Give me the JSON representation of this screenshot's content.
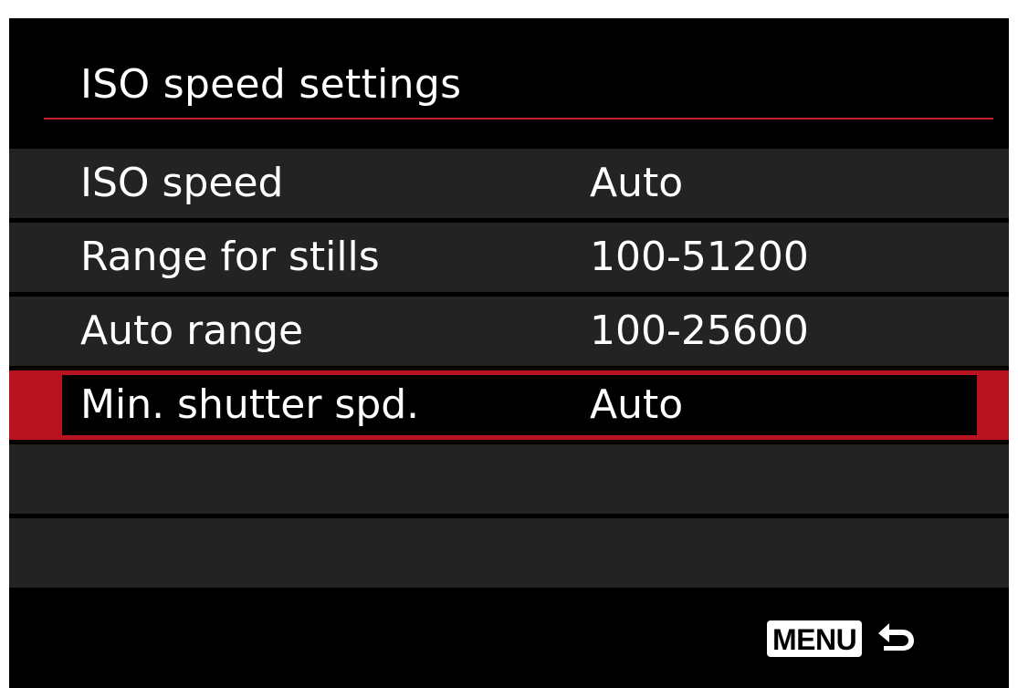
{
  "header": {
    "title": "ISO speed settings"
  },
  "menu": {
    "items": [
      {
        "label": "ISO speed",
        "value": "Auto"
      },
      {
        "label": "Range for stills",
        "value": "100-51200"
      },
      {
        "label": "Auto range",
        "value": "100-25600"
      },
      {
        "label": "Min. shutter spd.",
        "value": "Auto",
        "selected": true
      }
    ]
  },
  "footer": {
    "menu_button_label": "MENU",
    "return_icon": "return-arrow-icon"
  },
  "colors": {
    "accent": "#c0222a",
    "selection": "#b8131e",
    "background": "#000000",
    "row_background": "#232323",
    "text": "#ffffff"
  }
}
